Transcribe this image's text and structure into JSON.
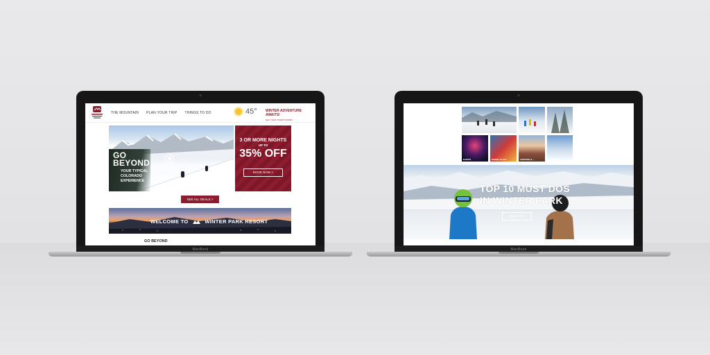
{
  "device_brand": "MacBook",
  "left_site": {
    "nav": {
      "logo_text": "WINTER PARK RESORT",
      "links": [
        "THE MOUNTAIN",
        "PLAN YOUR TRIP",
        "THINGS TO DO"
      ],
      "temperature": "45°",
      "weather_icon": "sun-icon",
      "adventure_title": "WINTER ADVENTURE AWAITS!",
      "adventure_sub": "GET YOUR TICKETS FROM"
    },
    "hero": {
      "title_line1": "GO",
      "title_line2": "BEYOND",
      "subtitle_line1": "YOUR TYPICAL",
      "subtitle_line2": "COLORADO",
      "subtitle_line3": "EXPERIENCE"
    },
    "promo": {
      "line1": "3 OR MORE NIGHTS",
      "line2": "UP TO",
      "line3": "35% OFF",
      "button": "BOOK NOW >"
    },
    "deals_button": "SEE ALL DEALS >",
    "welcome": {
      "prefix": "WELCOME TO",
      "name": "WINTER PARK RESORT"
    },
    "section_heading": "GO BEYOND"
  },
  "right_site": {
    "thumbnails": [
      {
        "caption": ""
      },
      {
        "caption": ""
      },
      {
        "caption": ""
      },
      {
        "caption": "EVENTS"
      },
      {
        "caption": "WHERE TO EAT"
      },
      {
        "caption": "SHOPPING & ..."
      },
      {
        "caption": "WHERE TO ..."
      }
    ],
    "banner": {
      "title_line1": "TOP 10 MUST DOS",
      "title_line2": "IN WINTER PARK",
      "button": "READ MORE"
    }
  },
  "colors": {
    "brand": "#8c1d2e",
    "background": "#e4e4e6"
  }
}
